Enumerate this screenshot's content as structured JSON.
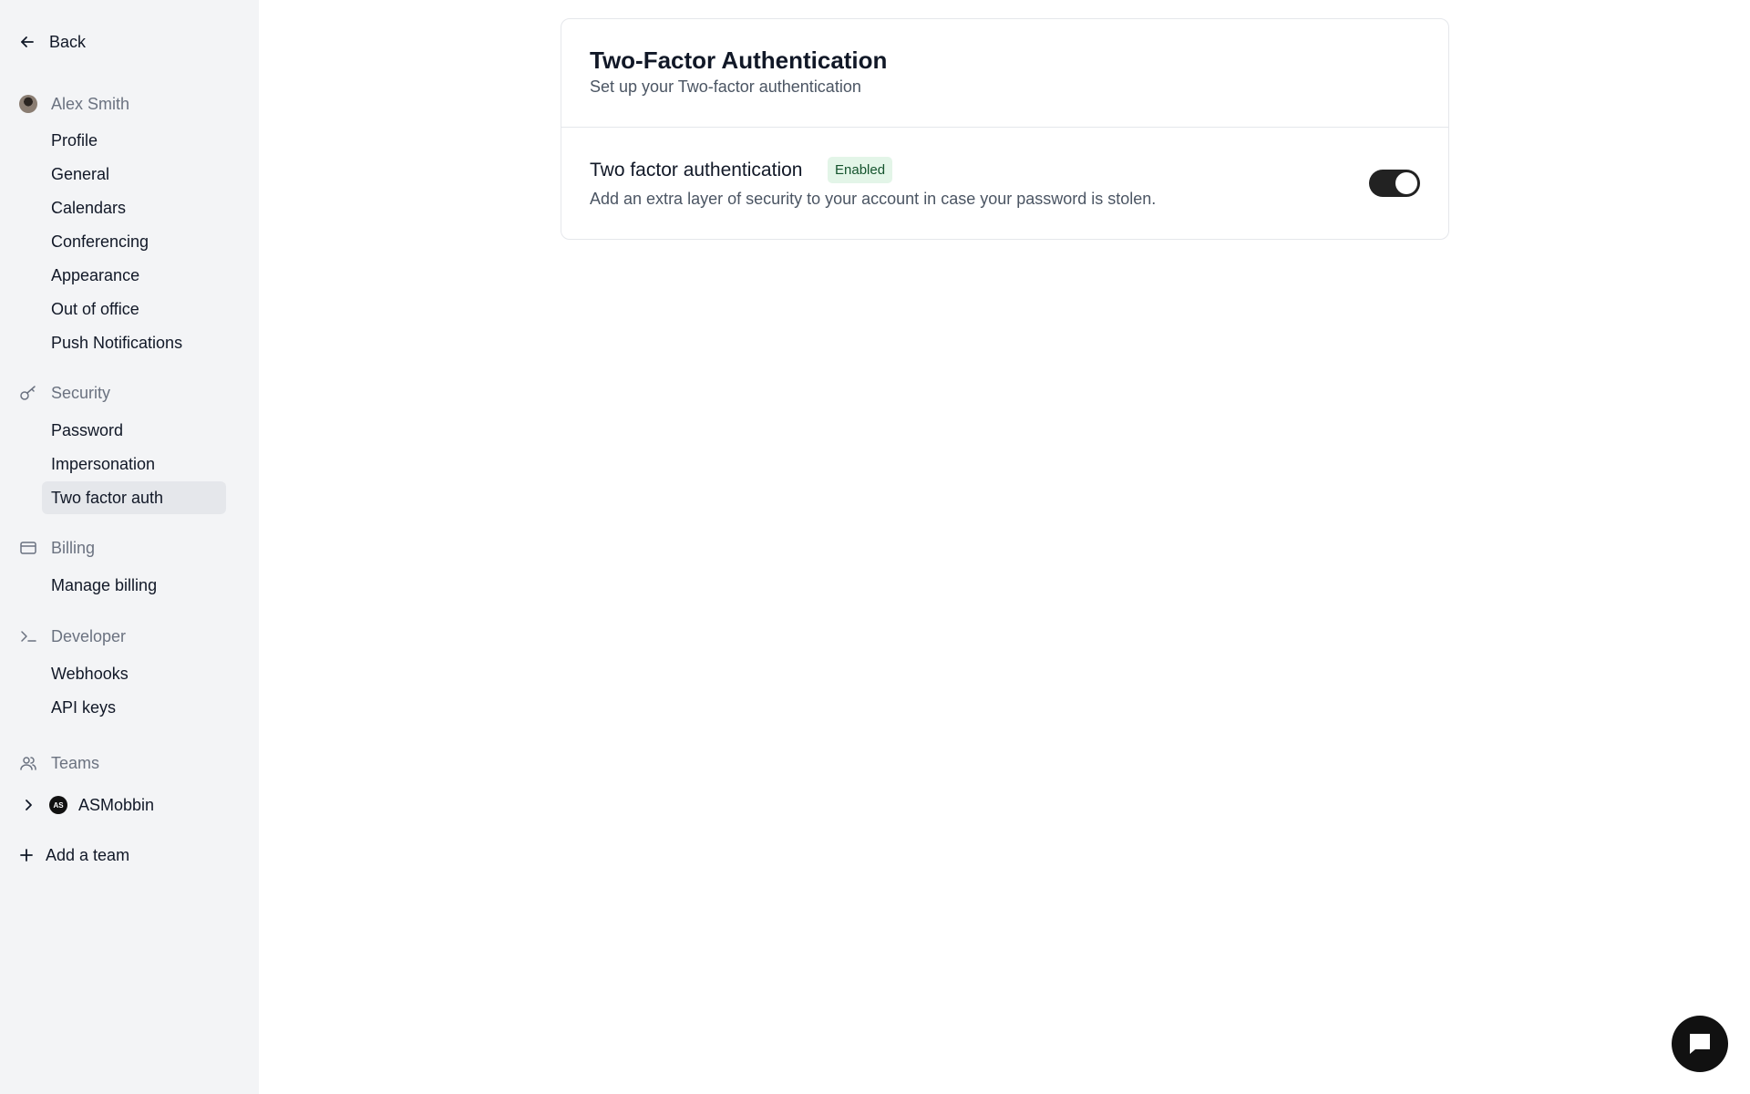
{
  "sidebar": {
    "back_label": "Back",
    "user_section": {
      "title": "Alex Smith",
      "items": [
        "Profile",
        "General",
        "Calendars",
        "Conferencing",
        "Appearance",
        "Out of office",
        "Push Notifications"
      ]
    },
    "security_section": {
      "title": "Security",
      "items": [
        "Password",
        "Impersonation",
        "Two factor auth"
      ],
      "active": "Two factor auth"
    },
    "billing_section": {
      "title": "Billing",
      "items": [
        "Manage billing"
      ]
    },
    "developer_section": {
      "title": "Developer",
      "items": [
        "Webhooks",
        "API keys"
      ]
    },
    "teams_section": {
      "title": "Teams",
      "team_name": "ASMobbin",
      "team_initials": "AS",
      "add_team_label": "Add a team"
    },
    "icons": {
      "back": "arrow-left-icon",
      "user": "avatar",
      "security": "key-icon",
      "billing": "credit-card-icon",
      "developer": "terminal-icon",
      "teams": "users-icon",
      "team_expand": "chevron-right-icon",
      "add_team": "plus-icon"
    }
  },
  "main": {
    "title": "Two-Factor Authentication",
    "subtitle": "Set up your Two-factor authentication",
    "setting": {
      "title": "Two factor authentication",
      "badge": "Enabled",
      "description": "Add an extra layer of security to your account in case your password is stolen.",
      "toggle_on": true
    }
  },
  "chat_button_icon": "chat-icon",
  "colors": {
    "sidebar_bg": "#f3f4f6",
    "active_item_bg": "#e5e7eb",
    "badge_bg": "#e3f5e8",
    "toggle_on": "#222222"
  }
}
